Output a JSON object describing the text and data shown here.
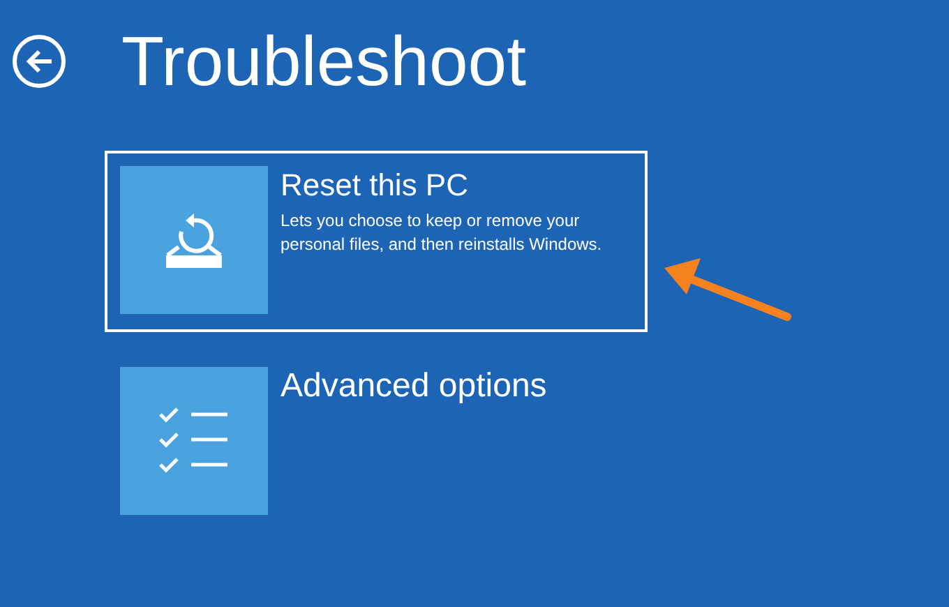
{
  "page": {
    "title": "Troubleshoot"
  },
  "options": [
    {
      "kind": "reset",
      "title": "Reset this PC",
      "description": "Lets you choose to keep or remove your personal files, and then reinstalls Windows.",
      "selected": true
    },
    {
      "kind": "advanced",
      "title": "Advanced options",
      "selected": false
    }
  ],
  "annotation": {
    "kind": "arrow"
  }
}
